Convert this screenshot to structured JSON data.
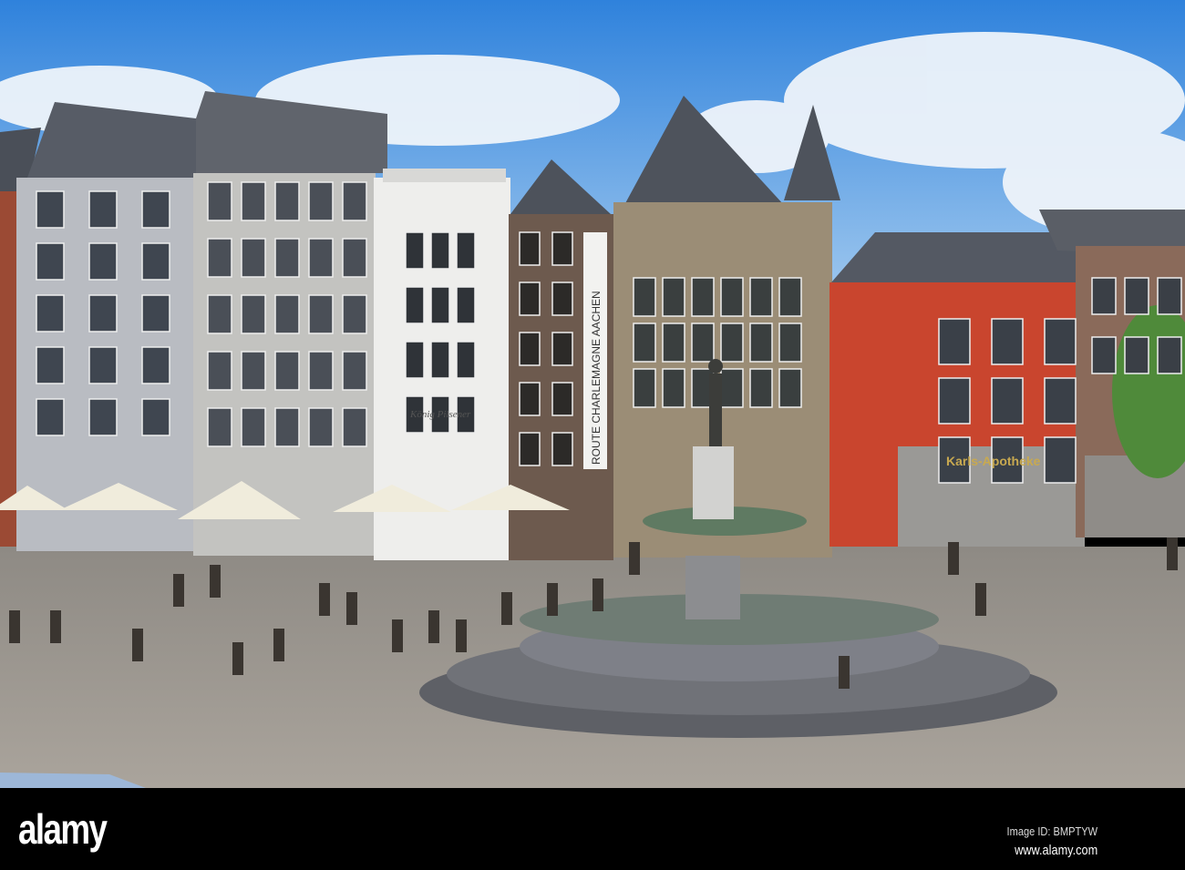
{
  "photo": {
    "signs": {
      "pharmacy": "Karls-Apotheke",
      "banner": "ROUTE CHARLEMAGNE AACHEN",
      "beer": "König Pilsener"
    },
    "colors": {
      "sky": "#3d8ee0",
      "plaza": "#a09a92",
      "red_building": "#c9452e"
    }
  },
  "watermark": {
    "logo": "alamy",
    "image_id": "Image ID: BMPTYW",
    "site": "www.alamy.com"
  }
}
